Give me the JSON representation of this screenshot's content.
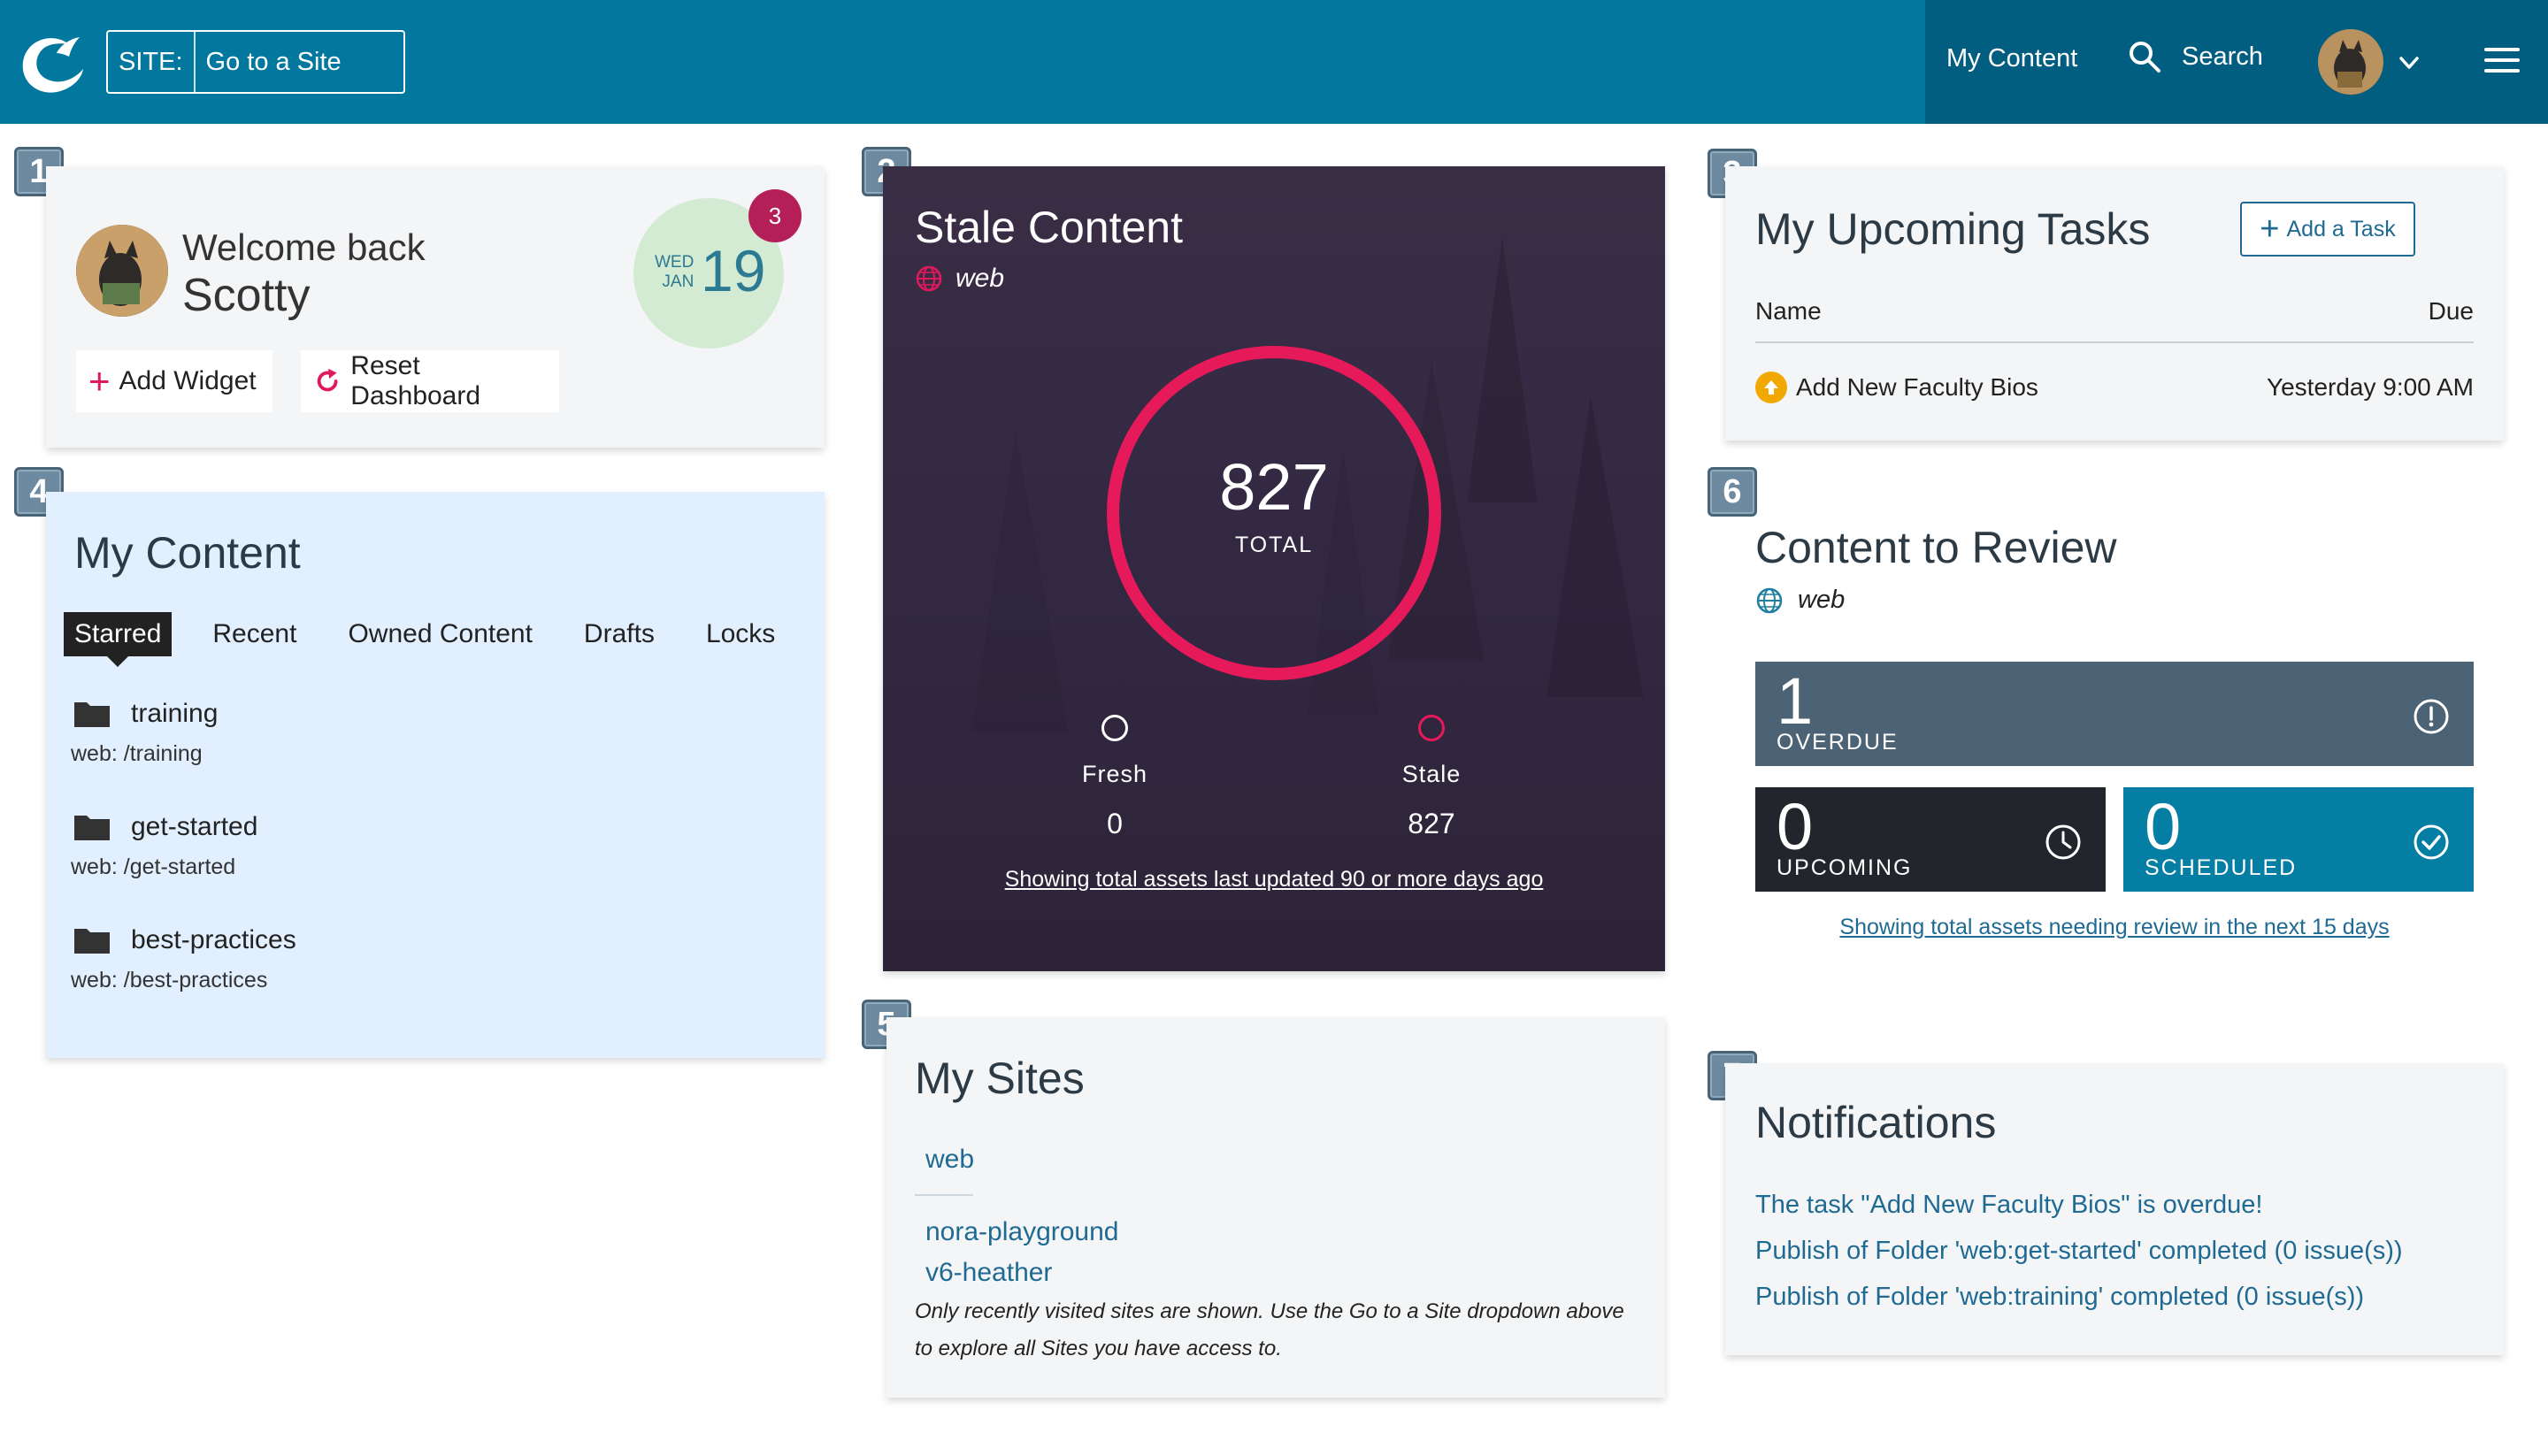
{
  "header": {
    "site_label": "SITE:",
    "site_value": "Go to a Site",
    "nav_my_content": "My Content",
    "nav_search": "Search"
  },
  "colors": {
    "header_bg": "#02789f",
    "header_right_bg": "#025e80",
    "accent_pink": "#e0195a",
    "link_blue": "#1f6a93"
  },
  "widget_numbers": [
    "1",
    "2",
    "3",
    "4",
    "5",
    "6",
    "7"
  ],
  "welcome": {
    "greeting": "Welcome back",
    "user_name": "Scotty",
    "date_dow": "WED",
    "date_month": "JAN",
    "date_day": "19",
    "notification_count": "3",
    "add_widget_label": "Add Widget",
    "reset_dashboard_label": "Reset Dashboard"
  },
  "my_content": {
    "title": "My Content",
    "tabs": [
      "Starred",
      "Recent",
      "Owned Content",
      "Drafts",
      "Locks"
    ],
    "active_tab": "Starred",
    "items": [
      {
        "name": "training",
        "path": "web: /training"
      },
      {
        "name": "get-started",
        "path": "web: /get-started"
      },
      {
        "name": "best-practices",
        "path": "web: /best-practices"
      }
    ]
  },
  "stale_content": {
    "title": "Stale Content",
    "site": "web",
    "total": "827",
    "total_label": "TOTAL",
    "fresh_label": "Fresh",
    "fresh_value": "0",
    "stale_label": "Stale",
    "stale_value": "827",
    "footer": "Showing total assets last updated 90 or more days ago"
  },
  "my_sites": {
    "title": "My Sites",
    "sites": [
      "web",
      "nora-playground",
      "v6-heather"
    ],
    "note": "Only recently visited sites are shown. Use the Go to a Site dropdown above to explore all Sites you have access to."
  },
  "tasks": {
    "title": "My Upcoming Tasks",
    "add_label": "Add a Task",
    "col_name": "Name",
    "col_due": "Due",
    "rows": [
      {
        "name": "Add New Faculty Bios",
        "due": "Yesterday 9:00 AM"
      }
    ]
  },
  "review": {
    "title": "Content to Review",
    "site": "web",
    "overdue_count": "1",
    "overdue_label": "OVERDUE",
    "upcoming_count": "0",
    "upcoming_label": "UPCOMING",
    "scheduled_count": "0",
    "scheduled_label": "SCHEDULED",
    "footer": "Showing total assets needing review in the next 15 days"
  },
  "notifications": {
    "title": "Notifications",
    "items": [
      "The task \"Add New Faculty Bios\" is overdue!",
      "Publish of Folder 'web:get-started' completed (0 issue(s))",
      "Publish of Folder 'web:training' completed (0 issue(s))"
    ]
  }
}
